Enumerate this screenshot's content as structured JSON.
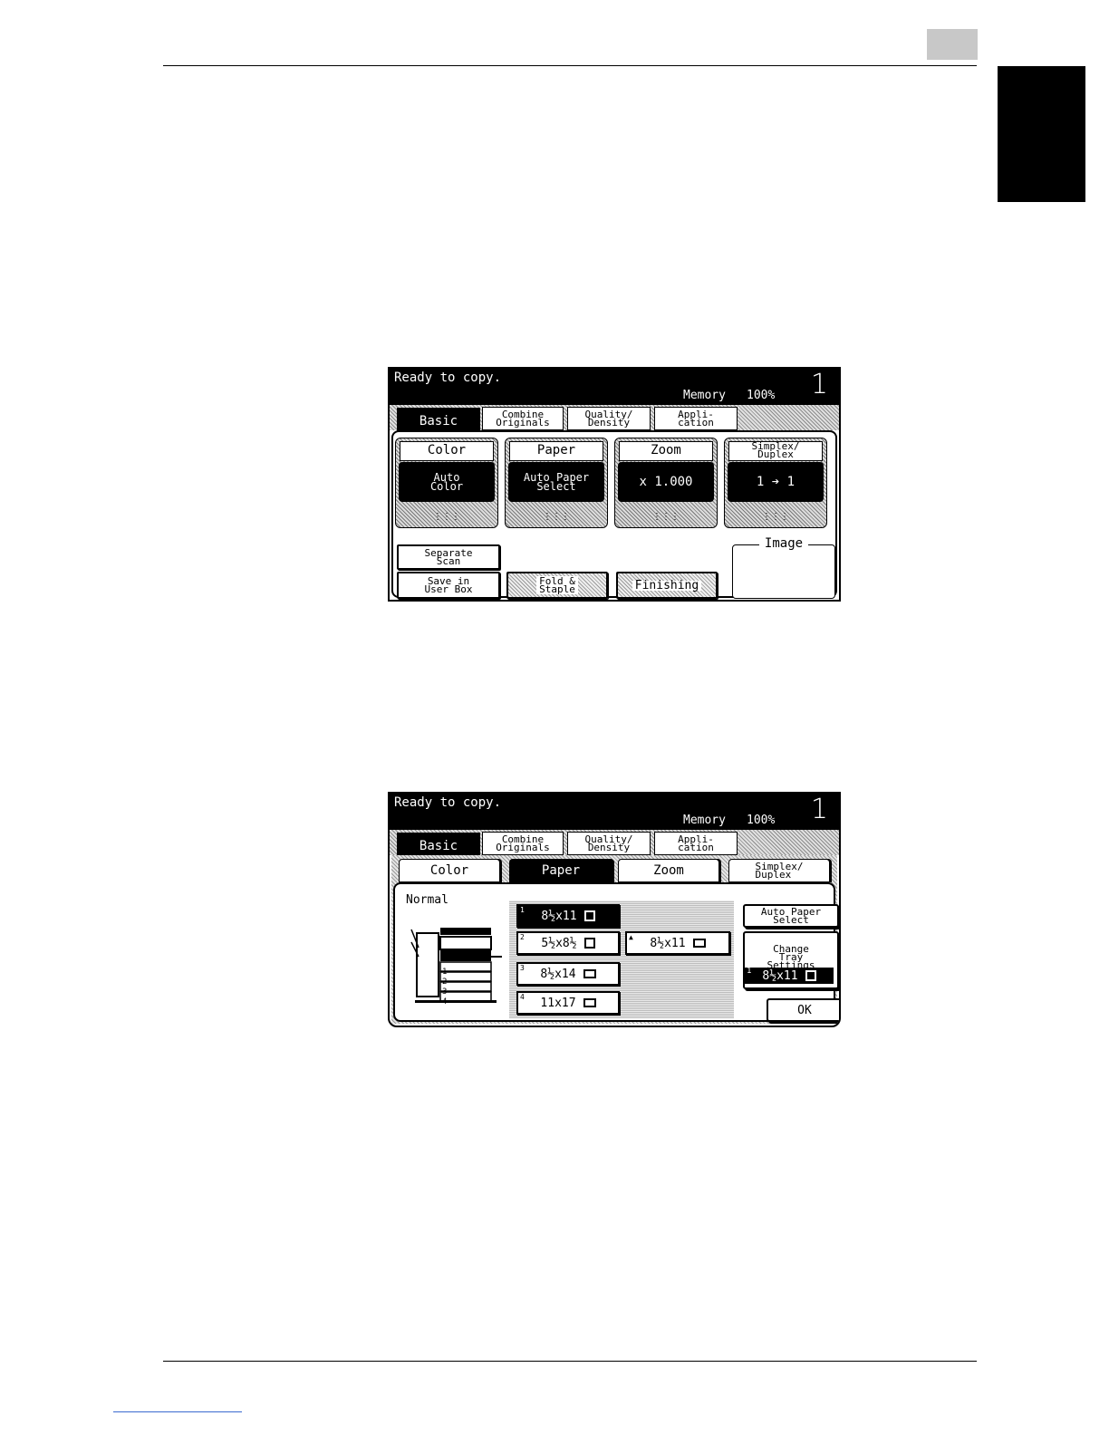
{
  "screen1": {
    "status": "Ready to copy.",
    "memory_label": "Memory",
    "memory_value": "100%",
    "copy_count": "1",
    "tabs": [
      "Basic",
      "Combine\nOriginals",
      "Quality/\nDensity",
      "Appli-\ncation"
    ],
    "functions": [
      {
        "title": "Color",
        "value": "Auto\nColor"
      },
      {
        "title": "Paper",
        "value": "Auto Paper\nSelect"
      },
      {
        "title": "Zoom",
        "value": "x 1.000"
      },
      {
        "title": "Simplex/\nDuplex",
        "value": "1 ➔ 1"
      }
    ],
    "dots": "⋮⋮⋮",
    "buttons": {
      "separate_scan": "Separate\nScan",
      "save_in_user_box": "Save in\nUser Box",
      "fold_staple": "Fold &\nStaple",
      "finishing": "Finishing"
    },
    "image_label": "Image"
  },
  "screen2": {
    "status": "Ready to copy.",
    "memory_label": "Memory",
    "memory_value": "100%",
    "copy_count": "1",
    "tabs": [
      "Basic",
      "Combine\nOriginals",
      "Quality/\nDensity",
      "Appli-\ncation"
    ],
    "function_tabs": [
      "Color",
      "Paper",
      "Zoom",
      "Simplex/\nDuplex"
    ],
    "mode_label": "Normal",
    "trays": [
      {
        "num": "1",
        "size": "8½x11"
      },
      {
        "num": "2",
        "size": "5½x8½"
      },
      {
        "num": "3",
        "size": "8½x14"
      },
      {
        "num": "4",
        "size": "11x17"
      }
    ],
    "bypass": {
      "num": "▲",
      "size": "8½x11"
    },
    "auto_paper_select": "Auto Paper\nSelect",
    "change_tray_settings": "Change\nTray\nSettings",
    "selected_num": "1",
    "selected_size": "8½x11",
    "ok": "OK",
    "machine_tray_labels": [
      "1",
      "2",
      "3",
      "4"
    ]
  }
}
